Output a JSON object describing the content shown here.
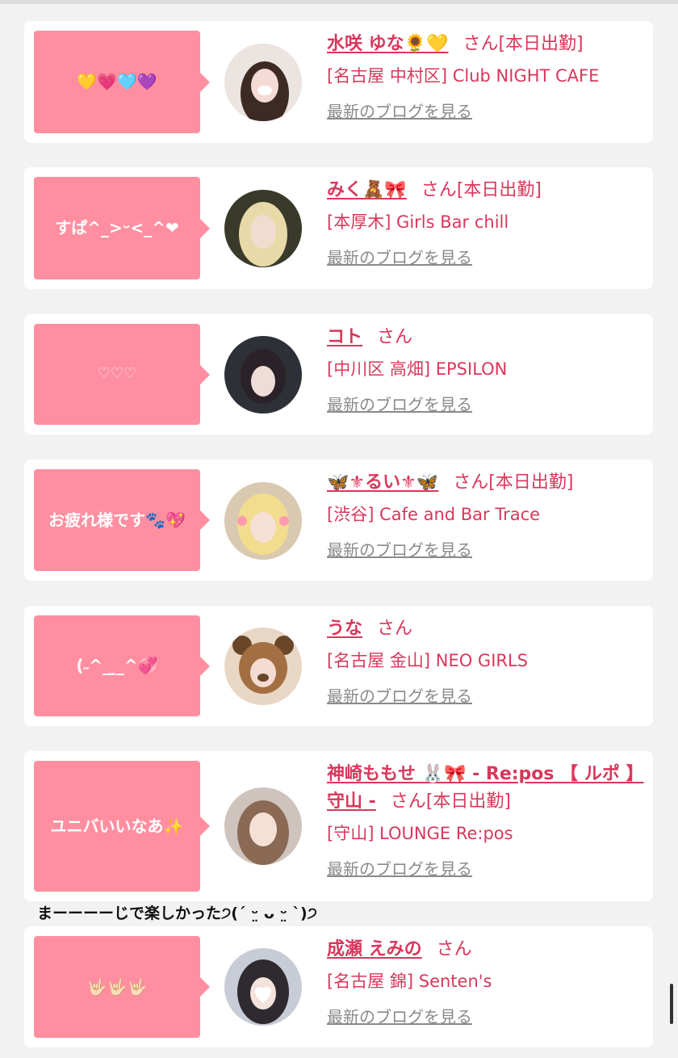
{
  "cards": [
    {
      "bubble": "💛💗🩵💜",
      "name": "水咲 ゆな🌻💛",
      "honorific": "さん",
      "status": "[本日出勤]",
      "shop": "[名古屋 中村区] Club NIGHT CAFE",
      "blog_link": "最新のブログを見る"
    },
    {
      "bubble": "すぱ^_>ᵕ<_^❤",
      "name": "みく🧸🎀",
      "honorific": "さん",
      "status": "[本日出勤]",
      "shop": "[本厚木] Girls Bar chill",
      "blog_link": "最新のブログを見る"
    },
    {
      "bubble": "♡♡♡",
      "name": "コト",
      "honorific": "さん",
      "status": "",
      "shop": "[中川区 高畑] EPSILON",
      "blog_link": "最新のブログを見る"
    },
    {
      "bubble": "お疲れ様です🐾💖",
      "name": "🦋⚜るい⚜🦋",
      "honorific": "さん",
      "status": "[本日出勤]",
      "shop": "[渋谷] Cafe and Bar Trace",
      "blog_link": "最新のブログを見る"
    },
    {
      "bubble": "(˶^_ ̫_^💞",
      "name": "うな",
      "honorific": "さん",
      "status": "",
      "shop": "[名古屋 金山] NEO GIRLS",
      "blog_link": "最新のブログを見る"
    },
    {
      "bubble": "ユニバいいなあ✨",
      "name": "神崎ももせ 🐰🎀 - Re:pos 【 ルポ 】守山 -",
      "honorific": "さん",
      "status": "[本日出勤]",
      "shop": "[守山] LOUNGE Re:pos",
      "blog_link": "最新のブログを見る"
    },
    {
      "bubble": "🤟🏻🤟🏻🤟🏻",
      "name": "成瀬 えみの",
      "honorific": "さん",
      "status": "",
      "shop": "[名古屋 錦] Senten's",
      "blog_link": "最新のブログを見る"
    }
  ],
  "caption": "まーーーーじで楽しかった੭(ˊ ᵕ̤ ᴗ ᵕ̤ ˋ)੭",
  "colors": {
    "accent": "#d9375b",
    "bubble": "#ff8fa0",
    "link_gray": "#8a8a8a",
    "background": "#f2f2f2"
  }
}
